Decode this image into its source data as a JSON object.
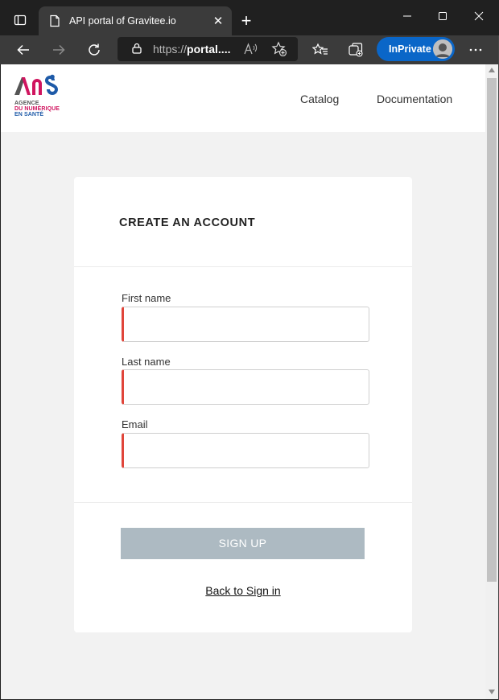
{
  "browser": {
    "tab_title": "API portal of Gravitee.io",
    "tab_close": "✕",
    "new_tab": "+",
    "url_scheme": "https://",
    "url_host": "portal....",
    "inprivate_label": "InPrivate"
  },
  "header": {
    "logo_lines": [
      "AGENCE",
      "DU NUMÉRIQUE",
      "EN SANTÉ"
    ],
    "nav": {
      "catalog": "Catalog",
      "documentation": "Documentation"
    }
  },
  "form": {
    "title": "CREATE AN ACCOUNT",
    "first_name_label": "First name",
    "first_name_value": "",
    "last_name_label": "Last name",
    "last_name_value": "",
    "email_label": "Email",
    "email_value": "",
    "signup_label": "SIGN UP",
    "back_link": "Back to Sign in"
  },
  "colors": {
    "accent_invalid": "#e0453a",
    "button_disabled": "#adbac2",
    "inprivate": "#0a66c8",
    "logo_red": "#d0155f",
    "logo_blue": "#1e5aa8"
  }
}
